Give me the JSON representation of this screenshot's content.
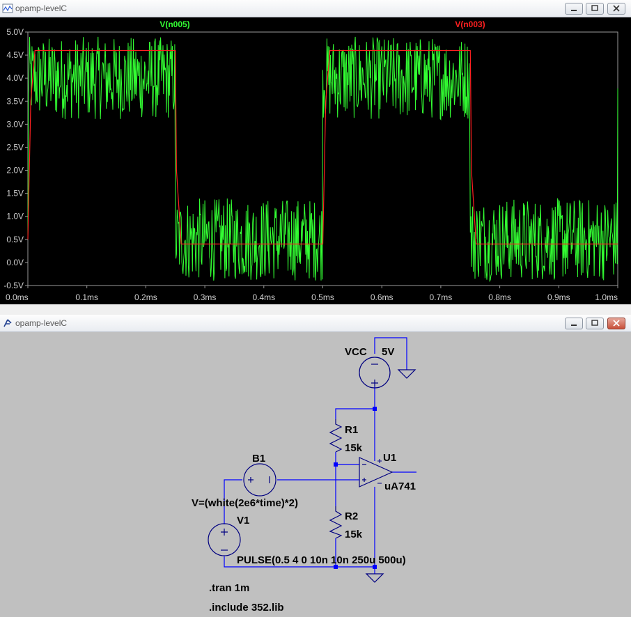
{
  "waveform_window": {
    "title": "opamp-levelC",
    "legend": {
      "green_label": "V(n005)",
      "red_label": "V(n003)"
    }
  },
  "schematic_window": {
    "title": "opamp-levelC",
    "labels": {
      "vcc_name": "VCC",
      "vcc_value": "5V",
      "r1_name": "R1",
      "r1_value": "15k",
      "r2_name": "R2",
      "r2_value": "15k",
      "u1_name": "U1",
      "u1_model": "uA741",
      "b1_name": "B1",
      "b1_expr": "V=(white(2e6*time)*2)",
      "v1_name": "V1",
      "v1_expr": "PULSE(0.5 4 0 10n 10n 250u 500u)",
      "tran_directive": ".tran 1m",
      "include_directive": ".include 352.lib"
    }
  },
  "colors": {
    "trace_green": "#33ff33",
    "trace_red": "#ff2020",
    "wire_blue": "#0000ff",
    "component_dark": "#000080",
    "plot_bg": "#000000",
    "schematic_bg": "#c0c0c0"
  },
  "icons": [
    "waveform-app-icon",
    "schematic-app-icon",
    "minimize-icon",
    "maximize-icon",
    "close-icon"
  ],
  "chart_data": {
    "type": "line",
    "xlabel": "",
    "ylabel": "",
    "xlim": [
      0,
      1.0
    ],
    "ylim": [
      -0.5,
      5.0
    ],
    "x_tick_labels": [
      "0.0ms",
      "0.1ms",
      "0.2ms",
      "0.3ms",
      "0.4ms",
      "0.5ms",
      "0.6ms",
      "0.7ms",
      "0.8ms",
      "0.9ms",
      "1.0ms"
    ],
    "y_tick_labels": [
      "5.0V",
      "4.5V",
      "4.0V",
      "3.5V",
      "3.0V",
      "2.5V",
      "2.0V",
      "1.5V",
      "1.0V",
      "0.5V",
      "0.0V",
      "-0.5V"
    ],
    "grid": false,
    "legend": "top",
    "series": [
      {
        "name": "V(n003)",
        "description_points_x_ms": [
          0.0,
          0.005,
          0.012,
          0.25,
          0.252,
          0.26,
          0.5,
          0.505,
          0.512,
          0.75,
          0.752,
          0.76,
          1.0
        ],
        "values": [
          0.5,
          3.5,
          4.6,
          4.6,
          2.0,
          0.4,
          0.4,
          3.5,
          4.6,
          4.6,
          2.0,
          0.4,
          0.4
        ]
      },
      {
        "name": "V(n005)",
        "pulse_high": 4.0,
        "pulse_low": 0.5,
        "noise_peak_to_peak": 2.0,
        "period_ms": 0.5,
        "high_width_ms": 0.25
      }
    ]
  }
}
